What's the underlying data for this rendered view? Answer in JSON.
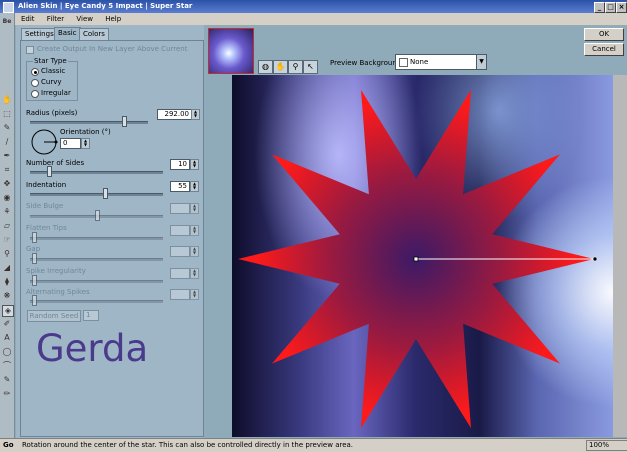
{
  "window": {
    "title": "Alien Skin | Eye Candy 5 Impact | Super Star"
  },
  "menu": [
    "Edit",
    "Filter",
    "View",
    "Help"
  ],
  "tabs": [
    "Settings",
    "Basic",
    "Colors"
  ],
  "basic": {
    "create_output_label": "Create Output In New Layer Above Current",
    "star_type": {
      "title": "Star Type",
      "options": [
        "Classic",
        "Curvy",
        "Irregular"
      ],
      "selected": "Classic"
    },
    "radius": {
      "label": "Radius (pixels)",
      "value": "292.00",
      "slider_fraction": 0.78
    },
    "orientation": {
      "label": "Orientation (°)",
      "value": "0"
    },
    "number_of_sides": {
      "label": "Number of Sides",
      "value": "10",
      "slider_fraction": 0.13
    },
    "indentation": {
      "label": "Indentation",
      "value": "55",
      "slider_fraction": 0.55
    },
    "side_bulge": {
      "label": "Side Bulge",
      "slider_fraction": 0.5
    },
    "flatten_tips": {
      "label": "Flatten Tips",
      "slider_fraction": 0.0
    },
    "gap": {
      "label": "Gap",
      "slider_fraction": 0.0
    },
    "spike_irregularity": {
      "label": "Spike Irregularity",
      "slider_fraction": 0.0
    },
    "alternating_spikes": {
      "label": "Alternating Spikes",
      "slider_fraction": 0.0
    },
    "random_seed": {
      "label": "Random Seed",
      "value": "1"
    }
  },
  "watermark_text": "Gerda",
  "buttons": {
    "ok": "OK",
    "cancel": "Cancel"
  },
  "preview_background": {
    "label": "Preview Background:",
    "value": "None"
  },
  "status": {
    "text": "Rotation around the center of the star.  This can also be controlled directly in the preview area.",
    "zoom": "100%",
    "corner": "Go"
  },
  "colors": {
    "star_outer": "#ff1a1a",
    "star_mid": "#9a1a40",
    "star_inner": "#3c1a66",
    "titlebar": "#2a52a8"
  },
  "icons": [
    "hand-icon",
    "zoom-icon",
    "arrow-icon",
    "dropdown-arrow-icon",
    "spin-arrows-icon"
  ]
}
